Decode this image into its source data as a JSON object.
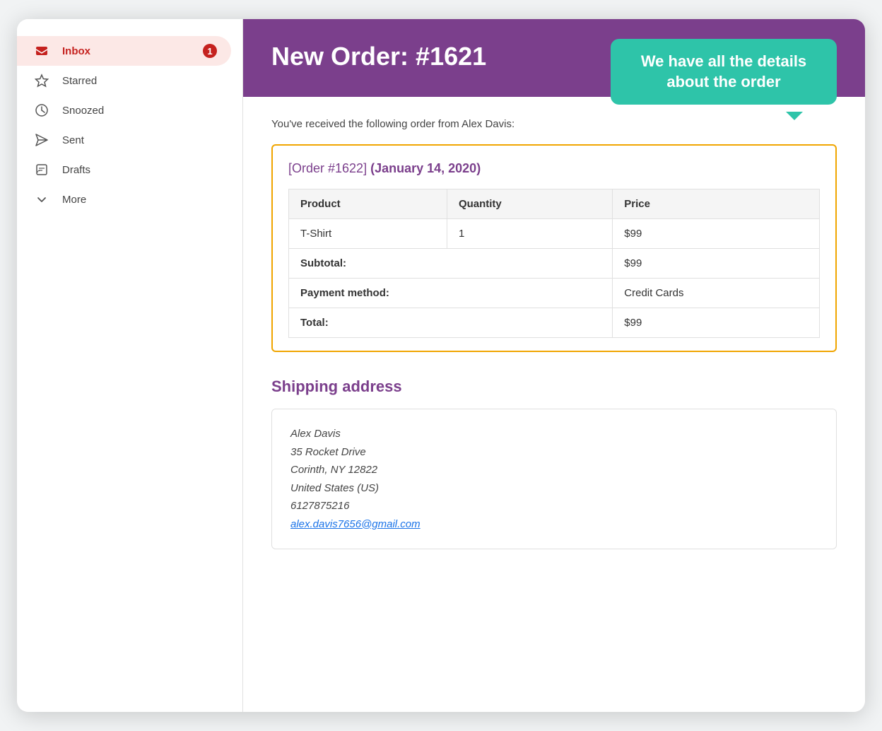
{
  "sidebar": {
    "items": [
      {
        "id": "inbox",
        "label": "Inbox",
        "badge": "1",
        "active": true
      },
      {
        "id": "starred",
        "label": "Starred",
        "badge": null,
        "active": false
      },
      {
        "id": "snoozed",
        "label": "Snoozed",
        "badge": null,
        "active": false
      },
      {
        "id": "sent",
        "label": "Sent",
        "badge": null,
        "active": false
      },
      {
        "id": "drafts",
        "label": "Drafts",
        "badge": null,
        "active": false
      },
      {
        "id": "more",
        "label": "More",
        "badge": null,
        "active": false
      }
    ]
  },
  "email": {
    "header_title": "New Order: #1621",
    "callout_text": "We have all the details about the order",
    "intro": "You've received the following order from Alex Davis:",
    "order_link_text": "[Order #1622]",
    "order_date": "(January 14, 2020)",
    "table": {
      "headers": [
        "Product",
        "Quantity",
        "Price"
      ],
      "rows": [
        {
          "product": "T-Shirt",
          "quantity": "1",
          "price": "$99"
        }
      ],
      "subtotal_label": "Subtotal:",
      "subtotal_value": "$99",
      "payment_label": "Payment method:",
      "payment_value": "Credit Cards",
      "total_label": "Total:",
      "total_value": "$99"
    },
    "shipping_heading": "Shipping address",
    "address": {
      "name": "Alex Davis",
      "line1": "35 Rocket Drive",
      "line2": "Corinth, NY 12822",
      "line3": "United States (US)",
      "phone": "6127875216",
      "email": "alex.davis7656@gmail.com"
    }
  },
  "colors": {
    "purple": "#7b3f8c",
    "teal": "#2ec4a9",
    "orange": "#f0a500",
    "red": "#c5221f",
    "inbox_bg": "#fce8e6"
  }
}
